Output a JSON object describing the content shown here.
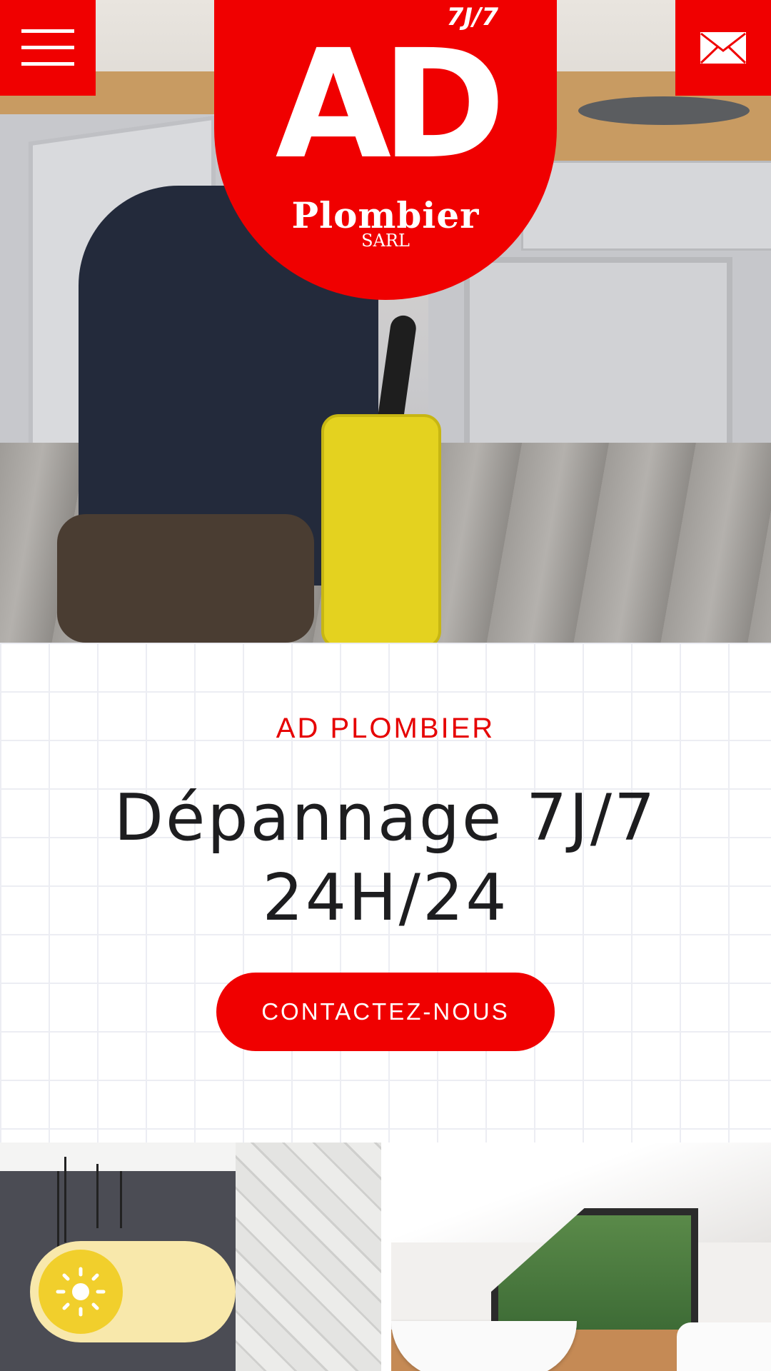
{
  "header": {
    "menu_icon": "hamburger-menu-icon",
    "mail_icon": "envelope-icon",
    "logo": {
      "badge": "7J/7",
      "monogram": "AD",
      "name": "Plombier",
      "suffix": "SARL"
    }
  },
  "intro": {
    "eyebrow": "AD PLOMBIER",
    "headline_line1": "Dépannage 7J/7",
    "headline_line2": "24H/24",
    "cta_label": "CONTACTEZ-NOUS"
  },
  "theme_toggle": {
    "icon": "sun-icon",
    "state": "light"
  },
  "colors": {
    "brand_red": "#f00000",
    "accent_text_red": "#e60000",
    "headline_dark": "#1d1d1f",
    "toggle_track": "#f8e8ab",
    "toggle_knob": "#f1cf2c",
    "grid_line": "#ecedf3"
  }
}
